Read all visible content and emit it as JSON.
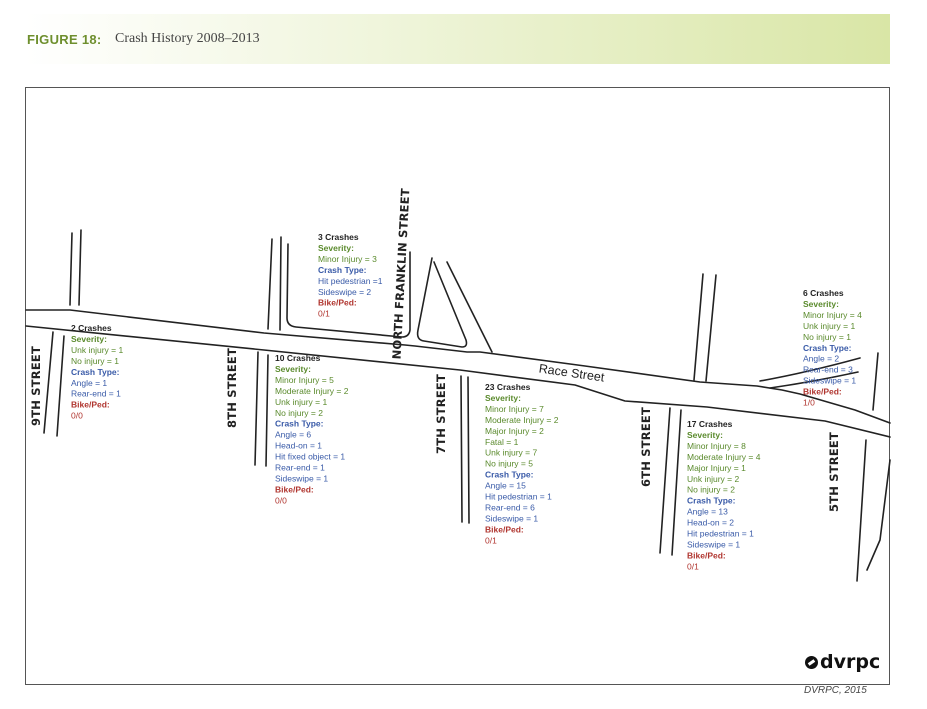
{
  "figure": {
    "label": "FIGURE 18:",
    "title": "Crash History 2008–2013"
  },
  "streets": {
    "ninth": "9TH STREET",
    "eighth": "8TH STREET",
    "seventh": "7TH STREET",
    "sixth": "6TH STREET",
    "fifth": "5TH STREET",
    "franklin": "NORTH FRANKLIN STREET",
    "race": "Race Street"
  },
  "labels": {
    "severity": "Severity:",
    "crash_type": "Crash Type:",
    "bike_ped": "Bike/Ped:"
  },
  "crash_groups": [
    {
      "id": "ninth-eighth",
      "title": "2 Crashes",
      "severity": [
        "Unk injury = 1",
        "No injury = 1"
      ],
      "crash_type": [
        "Angle = 1",
        "Rear-end = 1"
      ],
      "bike_ped": "0/0"
    },
    {
      "id": "franklin",
      "title": "3 Crashes",
      "severity": [
        "Minor Injury = 3"
      ],
      "crash_type": [
        "Hit pedestrian =1",
        "Sideswipe = 2"
      ],
      "bike_ped": "0/1"
    },
    {
      "id": "eighth-seventh",
      "title": "10 Crashes",
      "severity": [
        "Minor Injury = 5",
        "Moderate Injury = 2",
        "Unk injury = 1",
        "No injury = 2"
      ],
      "crash_type": [
        "Angle = 6",
        "Head-on = 1",
        "Hit fixed object = 1",
        "Rear-end = 1",
        "Sideswipe = 1"
      ],
      "bike_ped": "0/0"
    },
    {
      "id": "seventh-sixth",
      "title": "23 Crashes",
      "severity": [
        "Minor Injury = 7",
        "Moderate Injury = 2",
        "Major Injury = 2",
        "Fatal = 1",
        "Unk injury = 7",
        "No injury = 5"
      ],
      "crash_type": [
        "Angle = 15",
        "Hit pedestrian = 1",
        "Rear-end = 6",
        "Sideswipe = 1"
      ],
      "bike_ped": "0/1"
    },
    {
      "id": "sixth-fifth",
      "title": "17 Crashes",
      "severity": [
        "Minor Injury = 8",
        "Moderate Injury = 4",
        "Major Injury = 1",
        "Unk injury = 2",
        "No injury = 2"
      ],
      "crash_type": [
        "Angle = 13",
        "Head-on = 2",
        "Hit pedestrian = 1",
        "Sideswipe = 1"
      ],
      "bike_ped": "0/1"
    },
    {
      "id": "fifth-east",
      "title": "6 Crashes",
      "severity": [
        "Minor Injury = 4",
        "Unk injury = 1",
        "No injury = 1"
      ],
      "crash_type": [
        "Angle = 2",
        "Rear-end = 3",
        "Sideswipe = 1"
      ],
      "bike_ped": "1/0"
    }
  ],
  "logo": "dvrpc",
  "source": "DVRPC, 2015",
  "colors": {
    "severity": "#5a8a2c",
    "crash_type": "#3a5ba8",
    "bike_ped": "#b0352f",
    "header_fig": "#6e8f2e"
  }
}
